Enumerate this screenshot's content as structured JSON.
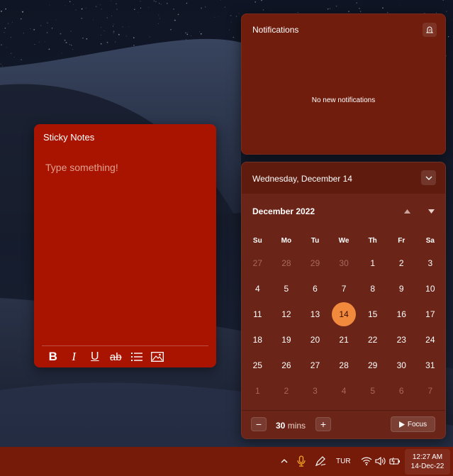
{
  "sticky_notes": {
    "title": "Sticky Notes",
    "placeholder": "Type something!",
    "toolbar": [
      {
        "name": "bold-icon",
        "label": "Bold"
      },
      {
        "name": "italic-icon",
        "label": "Italic"
      },
      {
        "name": "underline-icon",
        "label": "Underline"
      },
      {
        "name": "strikethrough-icon",
        "label": "Strikethrough"
      },
      {
        "name": "bullets-icon",
        "label": "Bullets"
      },
      {
        "name": "image-icon",
        "label": "Add image"
      }
    ]
  },
  "notifications": {
    "title": "Notifications",
    "empty_text": "No new notifications",
    "icon": "do-not-disturb-icon"
  },
  "calendar": {
    "date_header": "Wednesday, December 14",
    "month_label": "December 2022",
    "weekdays": [
      "Su",
      "Mo",
      "Tu",
      "We",
      "Th",
      "Fr",
      "Sa"
    ],
    "weeks": [
      [
        {
          "d": "27",
          "o": true
        },
        {
          "d": "28",
          "o": true
        },
        {
          "d": "29",
          "o": true
        },
        {
          "d": "30",
          "o": true
        },
        {
          "d": "1"
        },
        {
          "d": "2"
        },
        {
          "d": "3"
        }
      ],
      [
        {
          "d": "4"
        },
        {
          "d": "5"
        },
        {
          "d": "6"
        },
        {
          "d": "7"
        },
        {
          "d": "8"
        },
        {
          "d": "9"
        },
        {
          "d": "10"
        }
      ],
      [
        {
          "d": "11"
        },
        {
          "d": "12"
        },
        {
          "d": "13"
        },
        {
          "d": "14",
          "today": true
        },
        {
          "d": "15"
        },
        {
          "d": "16"
        },
        {
          "d": "17"
        }
      ],
      [
        {
          "d": "18"
        },
        {
          "d": "19"
        },
        {
          "d": "20"
        },
        {
          "d": "21"
        },
        {
          "d": "22"
        },
        {
          "d": "23"
        },
        {
          "d": "24"
        }
      ],
      [
        {
          "d": "25"
        },
        {
          "d": "26"
        },
        {
          "d": "27"
        },
        {
          "d": "28"
        },
        {
          "d": "29"
        },
        {
          "d": "30"
        },
        {
          "d": "31"
        }
      ],
      [
        {
          "d": "1",
          "o": true
        },
        {
          "d": "2",
          "o": true
        },
        {
          "d": "3",
          "o": true
        },
        {
          "d": "4",
          "o": true
        },
        {
          "d": "5",
          "o": true
        },
        {
          "d": "6",
          "o": true
        },
        {
          "d": "7",
          "o": true
        }
      ]
    ],
    "focus": {
      "minutes_value": "30",
      "minutes_unit": "mins",
      "minus_label": "−",
      "plus_label": "+",
      "focus_label": "Focus"
    }
  },
  "taskbar": {
    "language": "TUR",
    "time": "12:27 AM",
    "date": "14-Dec-22",
    "icons": [
      "chevron-up-icon",
      "microphone-icon",
      "pen-icon",
      "wifi-icon",
      "volume-icon",
      "battery-icon"
    ]
  },
  "colors": {
    "sticky_bg": "#a91400",
    "panel_bg": "#6a2518",
    "taskbar_bg": "#761a09",
    "today_accent": "#f28a3e"
  }
}
